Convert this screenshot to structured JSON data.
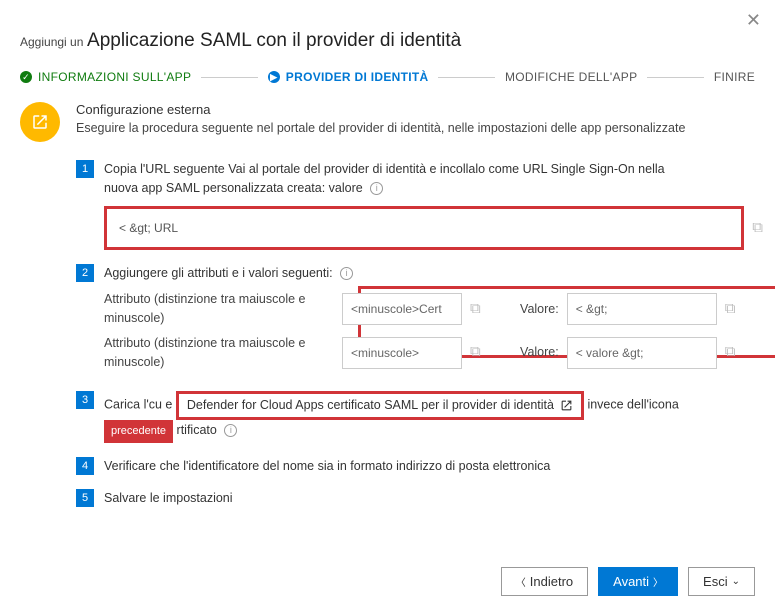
{
  "header": {
    "pretitle": "Aggiungi un",
    "title": "Applicazione SAML con il provider di identità"
  },
  "wizard": {
    "step1": "INFORMAZIONI SULL'APP",
    "step2": "PROVIDER DI IDENTITÀ",
    "step3": "MODIFICHE DELL'APP",
    "step4": "FINIRE"
  },
  "external": {
    "title": "Configurazione esterna",
    "desc": "Eseguire la procedura seguente nel portale del provider di identità, nelle impostazioni delle app personalizzate"
  },
  "items": {
    "n1": "1",
    "t1a": "Copia l'URL seguente Vai al portale del provider di identità e incollalo come URL Single Sign-On nella",
    "t1b": "nuova app SAML personalizzata creata: valore",
    "url_value": "< &gt; URL",
    "n2": "2",
    "t2": "Aggiungere gli attributi e i valori seguenti:",
    "attr_label1": "Attributo (distinzione tra maiuscole e minuscole)",
    "attr_label2": "Attributo (distinzione tra maiuscole e minuscole)",
    "attr_input1": "<minuscole>Cert",
    "attr_input2": "<minuscole>",
    "val_label": "Valore:",
    "val_input1": "< &gt;",
    "val_input2": "< valore &gt;",
    "n3": "3",
    "t3a": "Carica l'cu e",
    "t3link": "Defender for Cloud Apps certificato SAML per il provider di identità",
    "t3b": "invece dell'icona",
    "t3prev": "precedente",
    "t3c": "rtificato",
    "n4": "4",
    "t4": "Verificare che l'identificatore del nome sia in formato indirizzo di posta elettronica",
    "n5": "5",
    "t5": "Salvare le impostazioni"
  },
  "footer": {
    "back": "Indietro",
    "next": "Avanti",
    "exit": "Esci"
  }
}
